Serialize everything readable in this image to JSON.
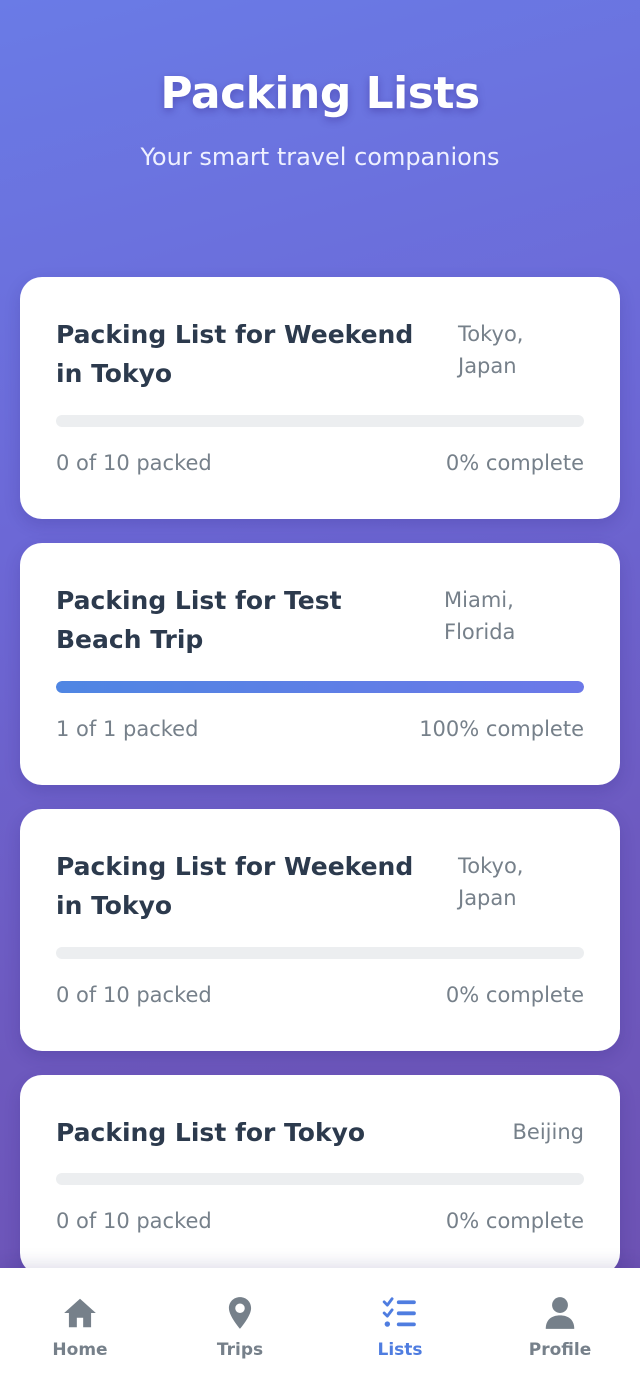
{
  "header": {
    "title": "Packing Lists",
    "subtitle": "Your smart travel companions"
  },
  "lists": [
    {
      "title": "Packing List for Weekend in Tokyo",
      "location": "Tokyo, Japan",
      "packed_text": "0 of 10 packed",
      "complete_text": "0% complete",
      "progress": 0
    },
    {
      "title": "Packing List for Test Beach Trip",
      "location": "Miami, Florida",
      "packed_text": "1 of 1 packed",
      "complete_text": "100% complete",
      "progress": 1.0
    },
    {
      "title": "Packing List for Weekend in Tokyo",
      "location": "Tokyo, Japan",
      "packed_text": "0 of 10 packed",
      "complete_text": "0% complete",
      "progress": 0
    },
    {
      "title": "Packing List for Tokyo",
      "location": "Beijing",
      "packed_text": "0 of 10 packed",
      "complete_text": "0% complete",
      "progress": 0
    }
  ],
  "tabbar": {
    "tabs": [
      {
        "label": "Home",
        "icon": "home-icon",
        "active": false
      },
      {
        "label": "Trips",
        "icon": "location-pin-icon",
        "active": false
      },
      {
        "label": "Lists",
        "icon": "checklist-icon",
        "active": true
      },
      {
        "label": "Profile",
        "icon": "person-icon",
        "active": false
      }
    ]
  },
  "colors": {
    "accent": "#4f7de0",
    "inactive": "#76808a",
    "title_text": "#2c3a4d"
  }
}
